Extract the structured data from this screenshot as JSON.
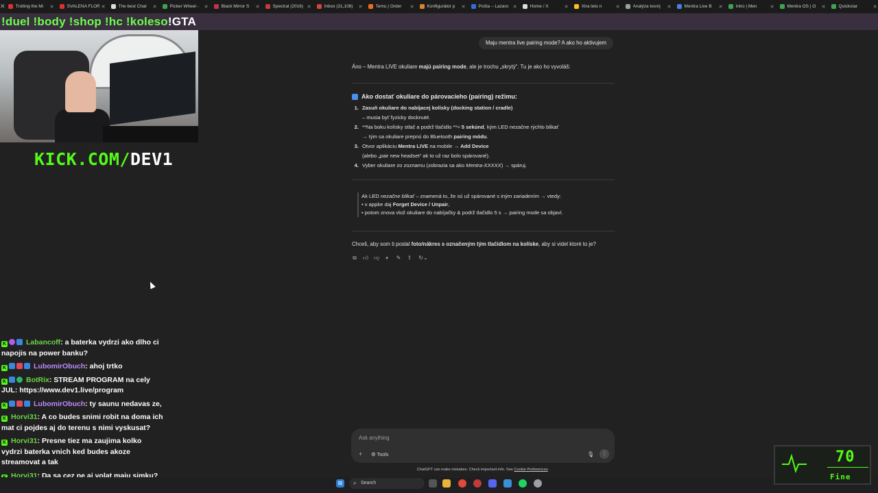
{
  "browser": {
    "tabs": [
      {
        "label": "Trolling the Mi",
        "color": "#e0302f"
      },
      {
        "label": "SVALENA FLOR",
        "color": "#e0302f"
      },
      {
        "label": "The best Chat",
        "color": "#dddddd"
      },
      {
        "label": "Picker Wheel -",
        "color": "#3fa34d"
      },
      {
        "label": "Black Mirror S",
        "color": "#c0344f"
      },
      {
        "label": "Spectral (2016)",
        "color": "#c63a3a"
      },
      {
        "label": "Inbox (31,108)",
        "color": "#d44638"
      },
      {
        "label": "Temu | Order",
        "color": "#f26b1d"
      },
      {
        "label": "Konfigurátor p",
        "color": "#d8842a"
      },
      {
        "label": "Pošta – Lazaro",
        "color": "#2f6fd6"
      },
      {
        "label": "Home / X",
        "color": "#dddddd"
      },
      {
        "label": "Xtra leto n",
        "color": "#f5c518"
      },
      {
        "label": "Analýza kovnj",
        "color": "#9aa0a6"
      },
      {
        "label": "Mentra Live B",
        "color": "#4a7fe0"
      },
      {
        "label": "Intro | Men",
        "color": "#3fa34d"
      },
      {
        "label": "Mentra OS | O",
        "color": "#3fa34d"
      },
      {
        "label": "Quickstar",
        "color": "#3fa34d"
      }
    ]
  },
  "stream": {
    "commands": "!duel !body !shop !hc !koleso",
    "commands_tail": "!GTA",
    "kick_prefix": "KICK.COM/",
    "kick_name": "DEV1"
  },
  "chat": [
    {
      "badges": [
        "k",
        "p",
        "b"
      ],
      "user": "Labancoff",
      "user_class": "user-green",
      "text": ": a baterka vydrzi ako dlho ci napojis na power banku?"
    },
    {
      "badges": [
        "k",
        "b",
        "r",
        "b"
      ],
      "user": "LubomirObuch",
      "user_class": "user-purple",
      "text": ": ahoj trtko"
    },
    {
      "badges": [
        "k",
        "b",
        "g"
      ],
      "user": "BotRix",
      "user_class": "user-bot",
      "text": ": STREAM PROGRAM na cely JUL: https://www.dev1.live/program"
    },
    {
      "badges": [
        "k",
        "b",
        "r",
        "b"
      ],
      "user": "LubomirObuch",
      "user_class": "user-purple",
      "text": ": ty saunu nedavas ze,"
    },
    {
      "badges": [
        "k"
      ],
      "user": "Horvi31",
      "user_class": "user-green",
      "text": ": A co budes snimi robit na doma ich mat ci pojdes aj do terenu s nimi vyskusat?"
    },
    {
      "badges": [
        "k"
      ],
      "user": "Horvi31",
      "user_class": "user-green",
      "text": ": Presne tiez ma zaujima kolko vydrzi baterka vnich ked budes akoze streamovat a tak"
    },
    {
      "badges": [
        "k"
      ],
      "user": "Horvi31",
      "user_class": "user-green",
      "text": ": Da sa cez ne aj volat maju simku?"
    }
  ],
  "conversation": {
    "user_message": "Maju mentra live pairing mode? A ako ho aktivujem",
    "intro_pre": "Áno – Mentra LIVE okuliare ",
    "intro_bold": "majú pairing mode",
    "intro_post": ", ale je trochu „skrytý“. Tu je ako ho vyvoláš:",
    "heading": "Ako dostať okuliare do párovacieho (pairing) režimu:",
    "steps": [
      {
        "num": "1.",
        "line1_bold": "Zasuň okuliare do nabíjacej kolísky (docking station / cradle)",
        "line1": "",
        "line2": "– musia byť fyzicky docknuté."
      },
      {
        "num": "2.",
        "line1_pre": "**Na boku kolísky stlač a podrž tlačidlo **≈ ",
        "line1_bold": "5 sekúnd",
        "line1": ", kým LED nezačne rýchlo blikať",
        "line2_pre": "→ tým sa okuliare prepnú do Bluetooth ",
        "line2_bold": "pairing módu",
        "line2": "."
      },
      {
        "num": "3.",
        "line1_pre": "Otvor aplikáciu ",
        "line1_bold": "Mentra LIVE",
        "line1_mid": " na mobile → ",
        "line1_bold2": "Add Device",
        "line2": "(alebo „pair new headset“ ak to už raz bolo spárované)."
      },
      {
        "num": "4.",
        "line1_pre": "Vyber okuliare zo zoznamu (zobrazia sa ako ",
        "line1_italic": "Mentra-XXXXX",
        "line1": ") → spáruj."
      }
    ],
    "quote": {
      "line1_pre": "Ak LED ",
      "line1_italic": "nezačne blikať",
      "line1": " – znamená to, že sú už spárované s iným zariadením → vtedy:",
      "line2_pre": "• v appke daj ",
      "line2_bold": "Forget Device / Unpair",
      "line2": ",",
      "line3": "• potom znova vlož okuliare do nabíjačky & podrž tlačidlo 5 s → pairing mode sa objaví."
    },
    "question_pre": "Chceš, aby som ti poslal ",
    "question_bold": "foto/nákres s označeným tým tlačidlom na kolíske",
    "question_post": ", aby si videl ktoré to je?"
  },
  "composer": {
    "placeholder": "Ask anything",
    "tools_label": "Tools",
    "disclaimer": "ChatGPT can make mistakes. Check important info. See ",
    "disclaimer_link": "Cookie Preferences",
    "disclaimer_end": "."
  },
  "taskbar": {
    "search_label": "Search"
  },
  "widget": {
    "value": "70",
    "status": "Fine"
  }
}
